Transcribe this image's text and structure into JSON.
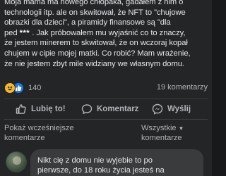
{
  "post": {
    "lines": [
      "Moja mama ma nowego chłopaka, gadałem z nim o",
      "technologii itp. ale on skwitował, że NFT to \"chujowe",
      "obrazki dla dzieci\", a piramidy finansowe są \"dla",
      ". Jak próbowałem mu wyjaśnić co to znaczy,",
      "że jestem minerem to skwitował, że on wczoraj kopał",
      "chujem w cipie mojej matki. Co robić? Mam wrażenie,",
      "że nie jestem zbyt mile widziany we własnym domu."
    ],
    "line4_prefix": "ped",
    "censored": "***"
  },
  "stats": {
    "reaction_count": "140",
    "comment_count": "19 komentarzy"
  },
  "actions": {
    "like": "Lubię to!",
    "comment": "Komentarz",
    "share": "Wyślij"
  },
  "comments_filter": {
    "show_earlier_line1": "Pokaż wcześniejsze",
    "show_earlier_line2": "komentarze",
    "sort_line1": "Wszystkie",
    "sort_line2": "komentarze"
  },
  "comment": {
    "lines": [
      "Nikt cię z domu nie wyjebie to po",
      "pierwsze, do 18 roku życia jesteś na"
    ]
  },
  "colors": {
    "background": "#242526",
    "text": "#e4e6eb",
    "secondary_text": "#b0b3b8",
    "like_blue": "#1877f2",
    "haha_yellow": "#f7b928"
  },
  "icons": [
    "haha-reaction-icon",
    "like-reaction-icon",
    "thumbs-up-icon",
    "comment-icon",
    "messenger-icon",
    "caret-down-icon",
    "avatar"
  ]
}
